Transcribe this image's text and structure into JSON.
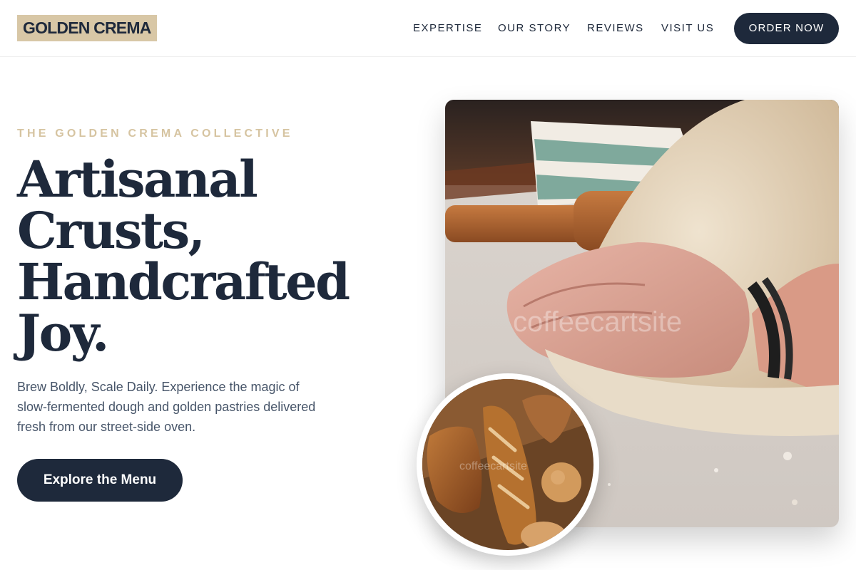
{
  "header": {
    "logo": "GOLDEN CREMA",
    "nav": [
      "EXPERTISE",
      "OUR STORY",
      "REVIEWS",
      "VISIT US"
    ],
    "order_button": "ORDER NOW"
  },
  "hero": {
    "eyebrow": "THE GOLDEN CREMA COLLECTIVE",
    "headline_lines": [
      "Artisanal",
      "Crusts,",
      "Handcrafted",
      "Joy."
    ],
    "subtext": "Brew Boldly, Scale Daily. Experience the magic of slow-fermented dough and golden pastries delivered fresh from our street-side oven.",
    "cta": "Explore the Menu"
  },
  "images": {
    "main_watermark": "coffeecartsite",
    "thumb_watermark": "coffeecartsite"
  },
  "colors": {
    "navy": "#1e293b",
    "gold": "#d8c7a6",
    "eyebrow": "#d6c4a1",
    "body_text": "#475569"
  }
}
